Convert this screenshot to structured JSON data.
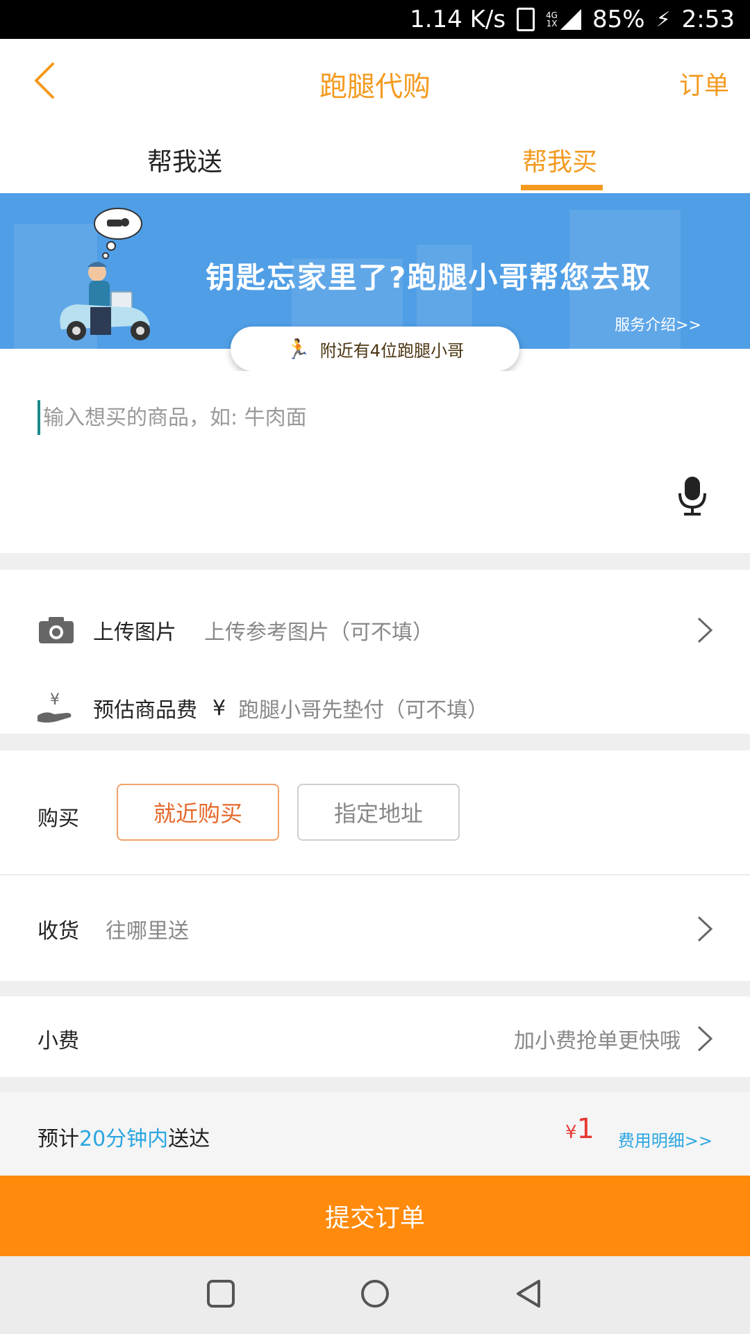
{
  "status_bar": {
    "speed": "1.14 K/s",
    "net_top": "4G",
    "net_bottom": "1X",
    "battery": "85%",
    "time": "2:53"
  },
  "header": {
    "title": "跑腿代购",
    "order_label": "订单"
  },
  "tabs": {
    "send": "帮我送",
    "buy": "帮我买"
  },
  "banner": {
    "headline": "钥匙忘家里了?跑腿小哥帮您去取",
    "service_link": "服务介绍>>",
    "nearby": "附近有4位跑腿小哥"
  },
  "goods": {
    "placeholder": "输入想买的商品，如: 牛肉面"
  },
  "upload": {
    "label": "上传图片",
    "hint": "上传参考图片（可不填）"
  },
  "estimate": {
    "label": "预估商品费",
    "currency": "¥",
    "hint": "跑腿小哥先垫付（可不填）"
  },
  "purchase": {
    "label": "购买",
    "option_near": "就近购买",
    "option_addr": "指定地址"
  },
  "receive": {
    "label": "收货",
    "hint": "往哪里送"
  },
  "tip": {
    "label": "小费",
    "hint": "加小费抢单更快哦"
  },
  "summary": {
    "eta_prefix": "预计",
    "eta_minutes": "20分钟内",
    "eta_suffix": "送达",
    "price_currency": "¥",
    "price_value": "1",
    "fee_detail": "费用明细>>"
  },
  "submit_label": "提交订单",
  "colors": {
    "accent": "#f39a1f",
    "banner": "#4f9ee6",
    "submit": "#ff8a0c",
    "link_blue": "#2aa6e0",
    "price_red": "#e53935"
  }
}
